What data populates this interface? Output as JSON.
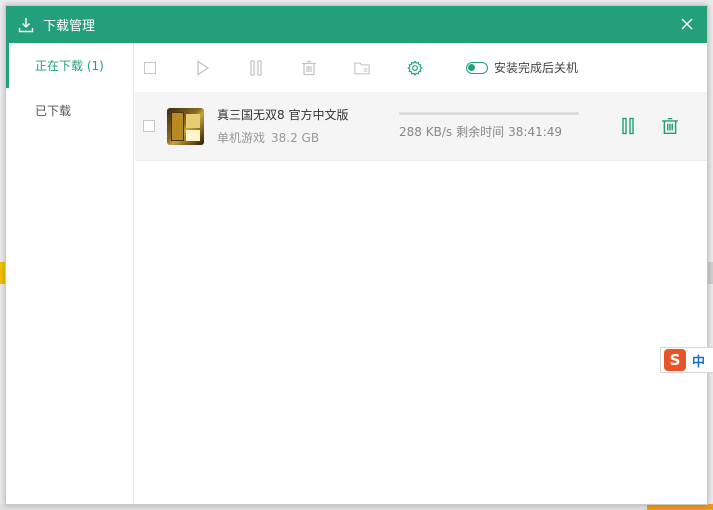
{
  "window": {
    "title": "下载管理",
    "accent_color": "#23a079"
  },
  "icons": {
    "title": "download-icon",
    "close": "close-icon"
  },
  "sidebar": {
    "items": [
      {
        "label": "正在下载 (1)",
        "active": true
      },
      {
        "label": "已下载",
        "active": false
      }
    ]
  },
  "toolbar": {
    "buttons": [
      "select-all-checkbox",
      "play-icon",
      "pause-icon",
      "trash-icon",
      "folder-icon",
      "gear-icon"
    ],
    "shutdown_toggle_label": "安装完成后关机",
    "shutdown_toggle_on": false
  },
  "downloads": [
    {
      "name": "真三国无双8 官方中文版",
      "category": "单机游戏",
      "size": "38.2 GB",
      "speed": "288 KB/s",
      "remaining_label": "剩余时间",
      "remaining_time": "38:41:49",
      "progress_percent": 0
    }
  ],
  "ime": {
    "logo": "S",
    "mode": "中"
  }
}
